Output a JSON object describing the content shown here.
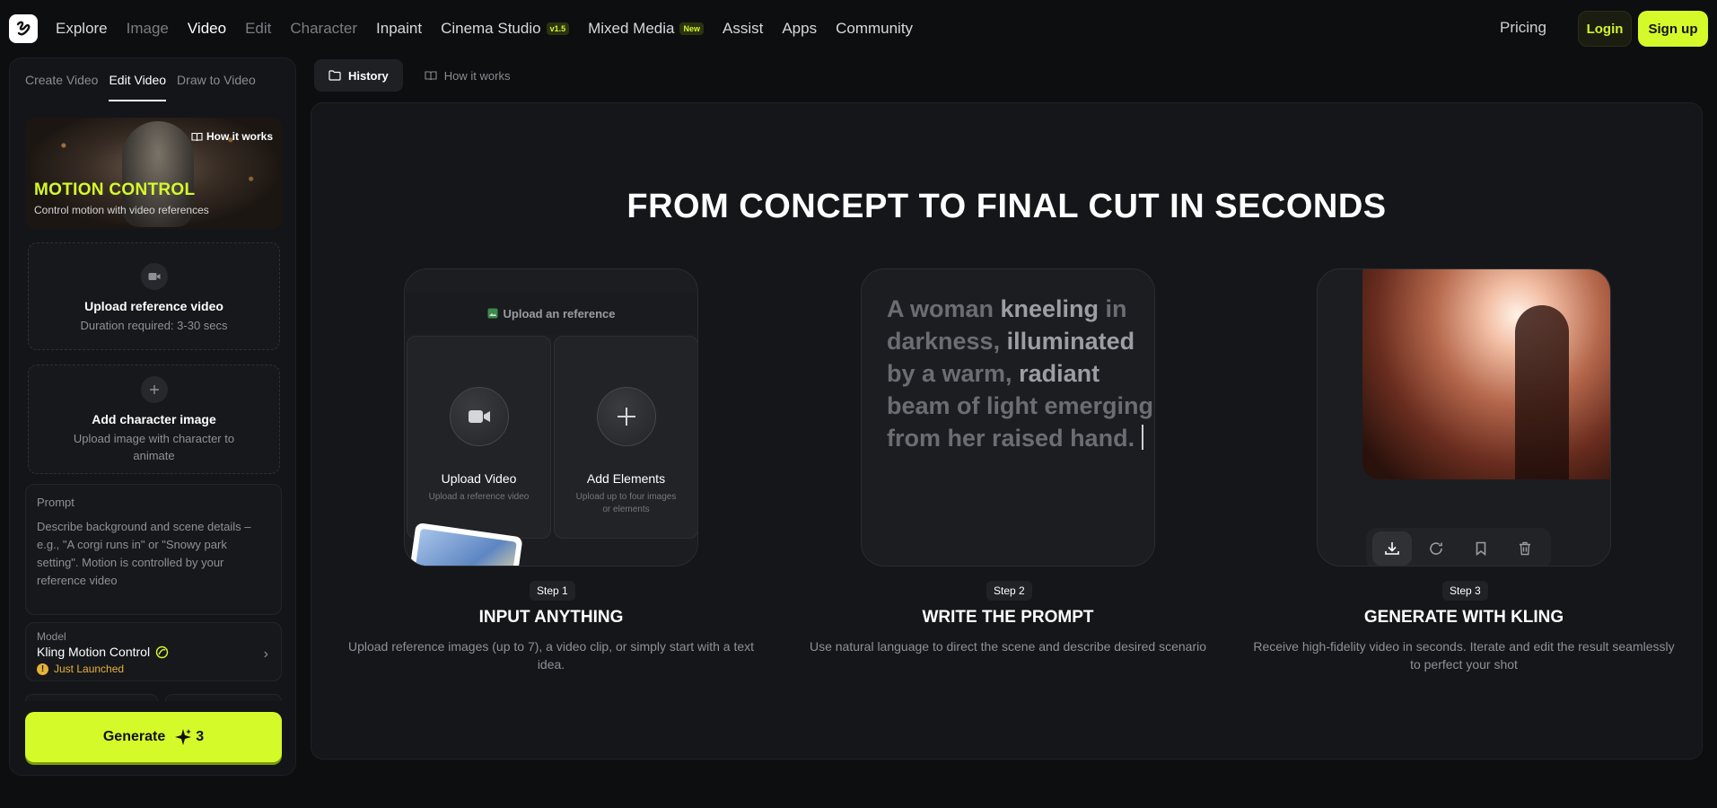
{
  "nav": {
    "items": [
      {
        "label": "Explore",
        "style": "normal"
      },
      {
        "label": "Image",
        "style": "dim"
      },
      {
        "label": "Video",
        "style": "active"
      },
      {
        "label": "Edit",
        "style": "dim"
      },
      {
        "label": "Character",
        "style": "dim"
      },
      {
        "label": "Inpaint",
        "style": "normal"
      },
      {
        "label": "Cinema Studio",
        "style": "normal",
        "badge": "v1.5"
      },
      {
        "label": "Mixed Media",
        "style": "normal",
        "badge": "New"
      },
      {
        "label": "Assist",
        "style": "normal"
      },
      {
        "label": "Apps",
        "style": "normal"
      },
      {
        "label": "Community",
        "style": "normal"
      }
    ],
    "pricing": "Pricing",
    "login": "Login",
    "signup": "Sign up"
  },
  "sidebar": {
    "tabs": [
      "Create Video",
      "Edit Video",
      "Draw to Video"
    ],
    "active_tab": "Edit Video",
    "hero": {
      "how_it_works": "How it works",
      "title": "MOTION CONTROL",
      "subtitle": "Control motion with video references"
    },
    "upload_video": {
      "title": "Upload reference video",
      "subtitle": "Duration required: 3-30 secs"
    },
    "add_character": {
      "title": "Add character image",
      "subtitle": "Upload image with character to animate"
    },
    "prompt": {
      "label": "Prompt",
      "placeholder": "Describe background and scene details – e.g., \"A corgi runs in\" or \"Snowy park setting\". Motion is controlled by your reference video"
    },
    "model": {
      "label": "Model",
      "name": "Kling Motion Control",
      "badge": "Just Launched"
    },
    "generate": {
      "label": "Generate",
      "credits": "3"
    }
  },
  "main": {
    "subtabs": [
      "History",
      "How it works"
    ],
    "headline": "FROM CONCEPT TO FINAL CUT IN SECONDS",
    "card1": {
      "header": "Upload an reference",
      "tile1_title": "Upload Video",
      "tile1_sub": "Upload a reference video",
      "tile2_title": "Add Elements",
      "tile2_sub": "Upload up to four images or elements"
    },
    "card2": {
      "text_parts": [
        {
          "t": "A woman ",
          "b": false
        },
        {
          "t": "kneeling",
          "b": true
        },
        {
          "t": " in darkness, ",
          "b": false
        },
        {
          "t": "illuminated",
          "b": true
        },
        {
          "t": " by a warm, ",
          "b": false
        },
        {
          "t": "radiant",
          "b": true
        },
        {
          "t": " beam of light emerging from her raised hand.",
          "b": false
        }
      ]
    },
    "steps": [
      {
        "badge": "Step 1",
        "title": "INPUT ANYTHING",
        "desc": "Upload reference images (up to 7), a video clip, or simply start with a text idea."
      },
      {
        "badge": "Step 2",
        "title": "WRITE THE PROMPT",
        "desc": "Use natural language to direct the scene and describe desired scenario"
      },
      {
        "badge": "Step 3",
        "title": "GENERATE WITH KLING",
        "desc": "Receive high-fidelity video in seconds. Iterate and edit the result seamlessly to perfect your shot"
      }
    ],
    "colors": {
      "accent": "#d5fa2a",
      "background": "#0d0e10",
      "panel": "#15161a"
    }
  }
}
